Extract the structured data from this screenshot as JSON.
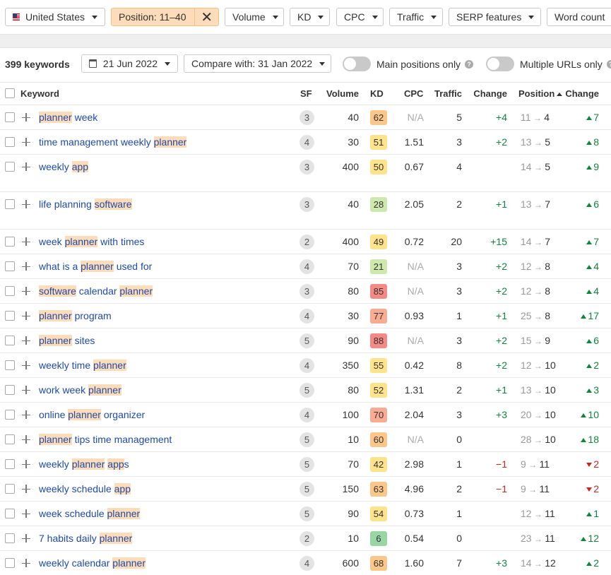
{
  "filters": {
    "country": "United States",
    "position": "Position: 11–40",
    "volume": "Volume",
    "kd": "KD",
    "cpc": "CPC",
    "traffic": "Traffic",
    "serp": "SERP features",
    "wordcount": "Word count"
  },
  "summary": {
    "count": "399 keywords",
    "date": "21 Jun 2022",
    "compare": "Compare with: 31 Jan 2022",
    "main_positions": "Main positions only",
    "multiple_urls": "Multiple URLs only"
  },
  "columns": {
    "keyword": "Keyword",
    "sf": "SF",
    "volume": "Volume",
    "kd": "KD",
    "cpc": "CPC",
    "traffic": "Traffic",
    "change": "Change",
    "position": "Position",
    "pos_change": "Change"
  },
  "colors": {
    "kd_green": "#99d6a5",
    "kd_light_green": "#cfe8ad",
    "kd_yellow": "#fde38c",
    "kd_orange": "#fbc68a",
    "kd_salmon": "#f8ab93",
    "kd_red": "#f48a86",
    "highlight": "#fddcb9",
    "link": "#1f4aa8",
    "positive": "#11843c",
    "negative": "#c6281d"
  },
  "rows": [
    {
      "parts": [
        [
          "planner",
          true
        ],
        [
          " week",
          false
        ]
      ],
      "sf": "3",
      "volume": "40",
      "kd": "62",
      "kd_color": "#fbc68a",
      "cpc": "N/A",
      "traffic": "5",
      "change": "+4",
      "pos_from": "11",
      "pos_to": "4",
      "pos_dir": "up",
      "pos_delta": "7",
      "tall": false
    },
    {
      "parts": [
        [
          "time management weekly ",
          false
        ],
        [
          "planner",
          true
        ]
      ],
      "sf": "4",
      "volume": "30",
      "kd": "51",
      "kd_color": "#fde38c",
      "cpc": "1.51",
      "traffic": "3",
      "change": "+2",
      "pos_from": "13",
      "pos_to": "5",
      "pos_dir": "up",
      "pos_delta": "8",
      "tall": false
    },
    {
      "parts": [
        [
          "weekly ",
          false
        ],
        [
          "app",
          true
        ]
      ],
      "sf": "3",
      "volume": "400",
      "kd": "50",
      "kd_color": "#fde38c",
      "cpc": "0.67",
      "traffic": "4",
      "change": "",
      "pos_from": "14",
      "pos_to": "5",
      "pos_dir": "up",
      "pos_delta": "9",
      "tall": true
    },
    {
      "parts": [
        [
          "life planning ",
          false
        ],
        [
          "software",
          true
        ]
      ],
      "sf": "3",
      "volume": "40",
      "kd": "28",
      "kd_color": "#cfe8ad",
      "cpc": "2.05",
      "traffic": "2",
      "change": "+1",
      "pos_from": "13",
      "pos_to": "7",
      "pos_dir": "up",
      "pos_delta": "6",
      "tall": true
    },
    {
      "parts": [
        [
          "week ",
          false
        ],
        [
          "planner",
          true
        ],
        [
          " with times",
          false
        ]
      ],
      "sf": "2",
      "volume": "400",
      "kd": "49",
      "kd_color": "#fde38c",
      "cpc": "0.72",
      "traffic": "20",
      "change": "+15",
      "pos_from": "14",
      "pos_to": "7",
      "pos_dir": "up",
      "pos_delta": "7",
      "tall": false
    },
    {
      "parts": [
        [
          "what is a ",
          false
        ],
        [
          "planner",
          true
        ],
        [
          " used for",
          false
        ]
      ],
      "sf": "4",
      "volume": "70",
      "kd": "21",
      "kd_color": "#cfe8ad",
      "cpc": "N/A",
      "traffic": "3",
      "change": "+2",
      "pos_from": "12",
      "pos_to": "8",
      "pos_dir": "up",
      "pos_delta": "4",
      "tall": false
    },
    {
      "parts": [
        [
          "software",
          true
        ],
        [
          " calendar ",
          false
        ],
        [
          "planner",
          true
        ]
      ],
      "sf": "3",
      "volume": "80",
      "kd": "85",
      "kd_color": "#f48a86",
      "cpc": "N/A",
      "traffic": "3",
      "change": "+2",
      "pos_from": "12",
      "pos_to": "8",
      "pos_dir": "up",
      "pos_delta": "4",
      "tall": false
    },
    {
      "parts": [
        [
          "planner",
          true
        ],
        [
          " program",
          false
        ]
      ],
      "sf": "4",
      "volume": "30",
      "kd": "77",
      "kd_color": "#f8ab93",
      "cpc": "0.93",
      "traffic": "1",
      "change": "+1",
      "pos_from": "25",
      "pos_to": "8",
      "pos_dir": "up",
      "pos_delta": "17",
      "tall": false
    },
    {
      "parts": [
        [
          "planner",
          true
        ],
        [
          " sites",
          false
        ]
      ],
      "sf": "5",
      "volume": "90",
      "kd": "88",
      "kd_color": "#f48a86",
      "cpc": "N/A",
      "traffic": "3",
      "change": "+2",
      "pos_from": "15",
      "pos_to": "9",
      "pos_dir": "up",
      "pos_delta": "6",
      "tall": false
    },
    {
      "parts": [
        [
          "weekly time ",
          false
        ],
        [
          "planner",
          true
        ]
      ],
      "sf": "4",
      "volume": "350",
      "kd": "55",
      "kd_color": "#fde38c",
      "cpc": "0.42",
      "traffic": "8",
      "change": "+2",
      "pos_from": "12",
      "pos_to": "10",
      "pos_dir": "up",
      "pos_delta": "2",
      "tall": false
    },
    {
      "parts": [
        [
          "work week ",
          false
        ],
        [
          "planner",
          true
        ]
      ],
      "sf": "5",
      "volume": "80",
      "kd": "52",
      "kd_color": "#fde38c",
      "cpc": "1.31",
      "traffic": "2",
      "change": "+1",
      "pos_from": "13",
      "pos_to": "10",
      "pos_dir": "up",
      "pos_delta": "3",
      "tall": false
    },
    {
      "parts": [
        [
          "online ",
          false
        ],
        [
          "planner",
          true
        ],
        [
          " organizer",
          false
        ]
      ],
      "sf": "4",
      "volume": "100",
      "kd": "70",
      "kd_color": "#f8ab93",
      "cpc": "2.04",
      "traffic": "3",
      "change": "+3",
      "pos_from": "20",
      "pos_to": "10",
      "pos_dir": "up",
      "pos_delta": "10",
      "tall": false
    },
    {
      "parts": [
        [
          "planner",
          true
        ],
        [
          " tips time management",
          false
        ]
      ],
      "sf": "5",
      "volume": "10",
      "kd": "60",
      "kd_color": "#fbc68a",
      "cpc": "N/A",
      "traffic": "0",
      "change": "",
      "pos_from": "28",
      "pos_to": "10",
      "pos_dir": "up",
      "pos_delta": "18",
      "tall": false
    },
    {
      "parts": [
        [
          "weekly ",
          false
        ],
        [
          "planner",
          true
        ],
        [
          " ",
          false
        ],
        [
          "app",
          true
        ],
        [
          "s",
          false
        ]
      ],
      "sf": "5",
      "volume": "70",
      "kd": "42",
      "kd_color": "#fde38c",
      "cpc": "2.98",
      "traffic": "1",
      "change": "−1",
      "pos_from": "9",
      "pos_to": "11",
      "pos_dir": "down",
      "pos_delta": "2",
      "tall": false
    },
    {
      "parts": [
        [
          "weekly schedule ",
          false
        ],
        [
          "app",
          true
        ]
      ],
      "sf": "5",
      "volume": "150",
      "kd": "63",
      "kd_color": "#fbc68a",
      "cpc": "4.96",
      "traffic": "2",
      "change": "−1",
      "pos_from": "9",
      "pos_to": "11",
      "pos_dir": "down",
      "pos_delta": "2",
      "tall": false
    },
    {
      "parts": [
        [
          "week schedule ",
          false
        ],
        [
          "planner",
          true
        ]
      ],
      "sf": "5",
      "volume": "90",
      "kd": "54",
      "kd_color": "#fde38c",
      "cpc": "0.73",
      "traffic": "1",
      "change": "",
      "pos_from": "12",
      "pos_to": "11",
      "pos_dir": "up",
      "pos_delta": "1",
      "tall": false
    },
    {
      "parts": [
        [
          "7 habits daily ",
          false
        ],
        [
          "planner",
          true
        ]
      ],
      "sf": "2",
      "volume": "10",
      "kd": "6",
      "kd_color": "#99d6a5",
      "cpc": "0.54",
      "traffic": "0",
      "change": "",
      "pos_from": "23",
      "pos_to": "11",
      "pos_dir": "up",
      "pos_delta": "12",
      "tall": false
    },
    {
      "parts": [
        [
          "weekly calendar ",
          false
        ],
        [
          "planner",
          true
        ]
      ],
      "sf": "4",
      "volume": "600",
      "kd": "68",
      "kd_color": "#fbc68a",
      "cpc": "1.60",
      "traffic": "7",
      "change": "+3",
      "pos_from": "14",
      "pos_to": "12",
      "pos_dir": "up",
      "pos_delta": "2",
      "tall": false
    }
  ]
}
